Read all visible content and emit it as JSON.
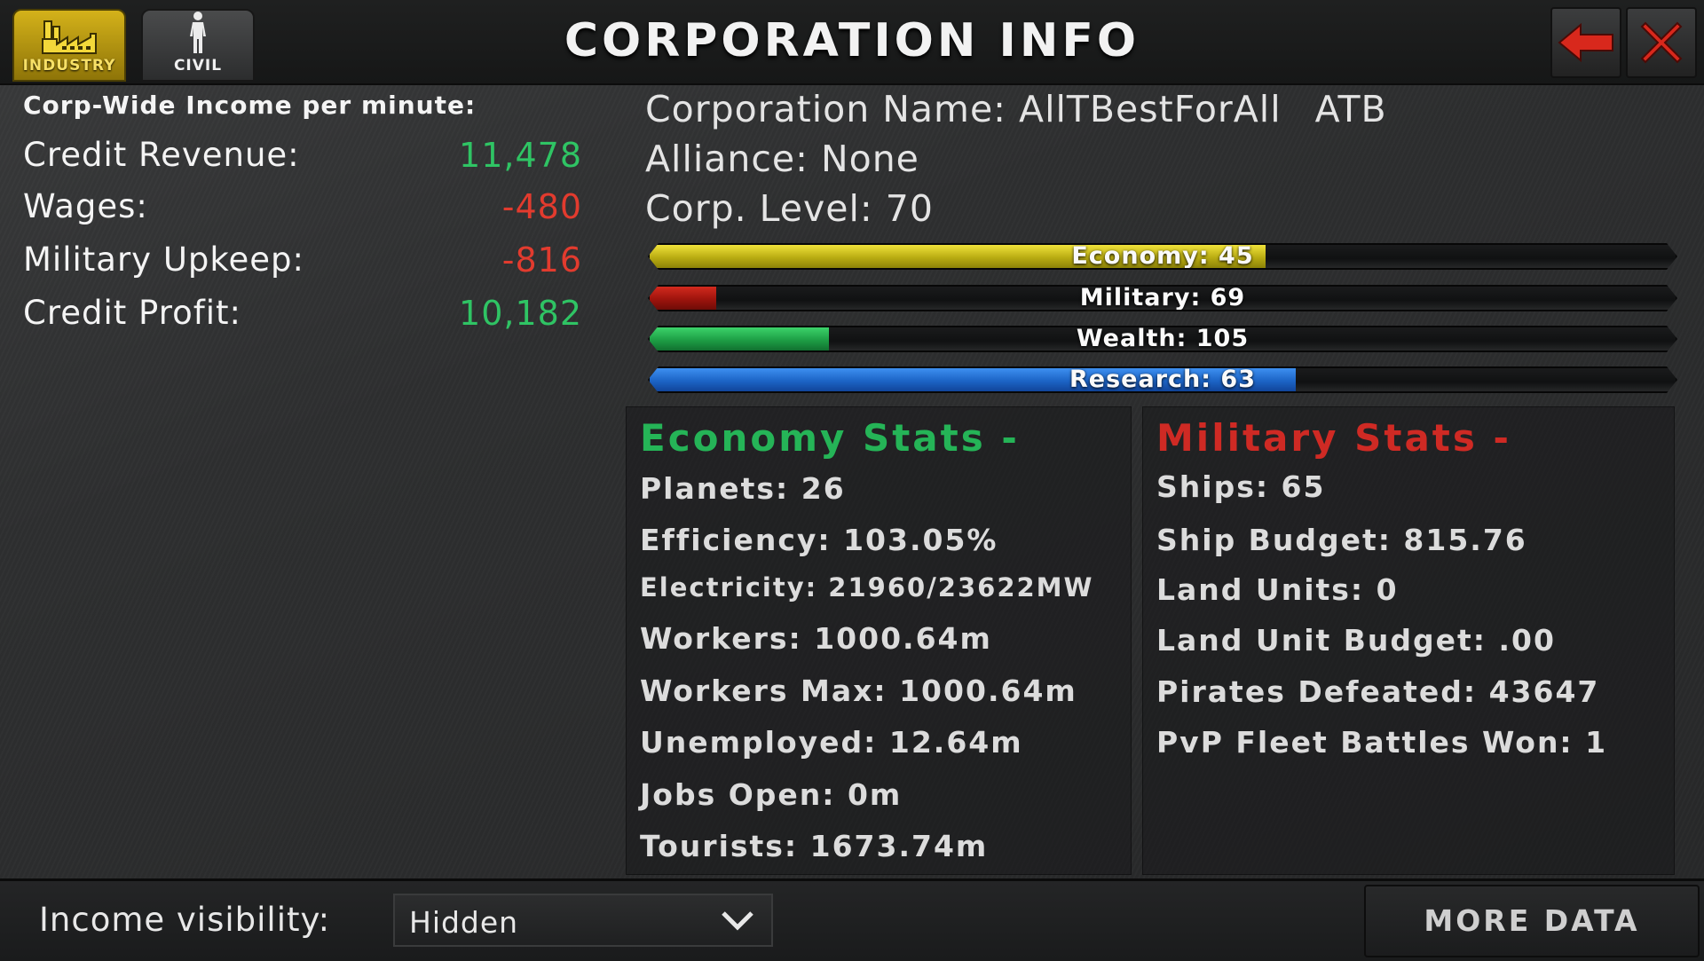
{
  "header": {
    "title": "CORPORATION INFO",
    "tabs": [
      {
        "label": "INDUSTRY",
        "icon": "factory-icon",
        "active": true
      },
      {
        "label": "CIVIL",
        "icon": "person-icon",
        "active": false
      }
    ],
    "back_icon": "back-arrow-icon",
    "close_icon": "close-icon"
  },
  "income": {
    "header": "Corp-Wide Income per minute:",
    "rows": [
      {
        "label": "Credit Revenue:",
        "value": "11,478",
        "color": "#2fc464"
      },
      {
        "label": "Wages:",
        "value": "-480",
        "color": "#e23b2e"
      },
      {
        "label": "Military Upkeep:",
        "value": "-816",
        "color": "#e23b2e"
      },
      {
        "label": "Credit Profit:",
        "value": "10,182",
        "color": "#2fc464"
      }
    ]
  },
  "corp": {
    "name_line": "Corporation Name: AllTBestForAll",
    "tag": "ATB",
    "alliance_line": "Alliance: None",
    "level_line": "Corp. Level: 70"
  },
  "bars": [
    {
      "label": "Economy: 45",
      "fill_fraction": 0.6,
      "color": "#d6c81c"
    },
    {
      "label": "Military: 69",
      "fill_fraction": 0.065,
      "color": "#b3180f"
    },
    {
      "label": "Wealth: 105",
      "fill_fraction": 0.175,
      "color": "#22a84b"
    },
    {
      "label": "Research: 63",
      "fill_fraction": 0.63,
      "color": "#2470d3"
    }
  ],
  "economy_stats": {
    "title": "Economy Stats -",
    "lines": [
      "Planets: 26",
      "Efficiency: 103.05%",
      "Electricity: 21960/23622MW",
      "Workers: 1000.64m",
      "Workers Max: 1000.64m",
      "Unemployed: 12.64m",
      "Jobs Open: 0m",
      "Tourists: 1673.74m"
    ]
  },
  "military_stats": {
    "title": "Military Stats -",
    "lines": [
      "Ships: 65",
      "Ship Budget: 815.76",
      "Land Units: 0",
      "Land Unit Budget: .00",
      "Pirates Defeated: 43647",
      "PvP Fleet Battles Won: 1"
    ]
  },
  "footer": {
    "visibility_label": "Income visibility:",
    "visibility_value": "Hidden",
    "more_button": "MORE DATA"
  }
}
